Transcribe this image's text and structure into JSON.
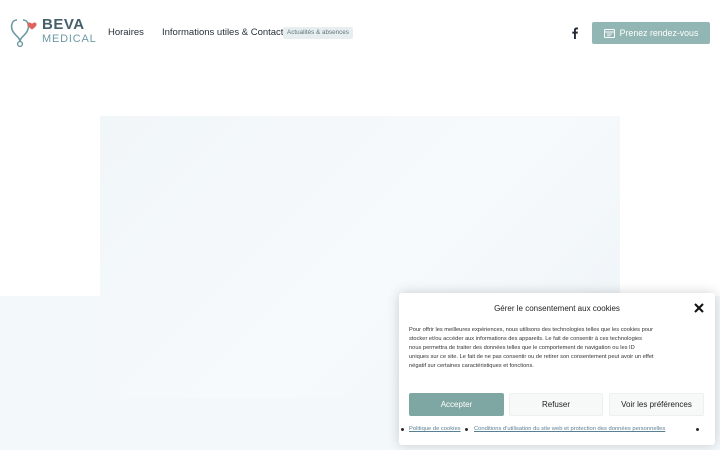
{
  "header": {
    "logo": {
      "name": "BEVA",
      "sub": "MEDICAL"
    },
    "nav": {
      "horaires": "Horaires",
      "infos": "Informations utiles & Contact",
      "badge": "Actualités & absences"
    },
    "social_icon": "facebook-icon",
    "cta": {
      "label": "Prenez rendez-vous",
      "icon": "calendar-icon"
    }
  },
  "cookie": {
    "title": "Gérer le consentement aux cookies",
    "text": "Pour offrir les meilleures expériences, nous utilisons des technologies telles que les cookies pour stocker et/ou accéder aux informations des appareils. Le fait de consentir à ces technologies nous permettra de traiter des données telles que le comportement de navigation ou les ID uniques sur ce site. Le fait de ne pas consentir ou de retirer son consentement peut avoir un effet négatif sur certaines caractéristiques et fonctions.",
    "buttons": {
      "accept": "Accepter",
      "refuse": "Refuser",
      "prefs": "Voir les préférences"
    },
    "links": {
      "policy": "Politique de cookies",
      "terms": "Conditions d'utilisation du site web et protection des données personnelles"
    }
  },
  "colors": {
    "accent": "#92b6b3",
    "accept": "#7ea6a3",
    "brand_text": "#45606c",
    "link": "#5a7f95",
    "band": "#f3f8fa"
  }
}
